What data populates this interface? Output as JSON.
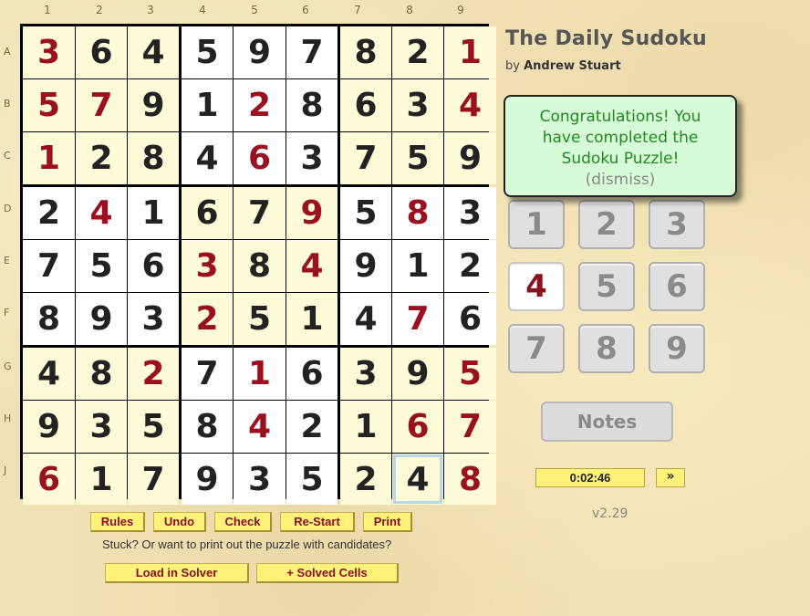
{
  "column_numbers": [
    "1",
    "2",
    "3",
    "4",
    "5",
    "6",
    "7",
    "8",
    "9"
  ],
  "row_letters": [
    "A",
    "B",
    "C",
    "D",
    "E",
    "F",
    "G",
    "H",
    "J"
  ],
  "grid": [
    [
      "3",
      "6",
      "4",
      "5",
      "9",
      "7",
      "8",
      "2",
      "1"
    ],
    [
      "5",
      "7",
      "9",
      "1",
      "2",
      "8",
      "6",
      "3",
      "4"
    ],
    [
      "1",
      "2",
      "8",
      "4",
      "6",
      "3",
      "7",
      "5",
      "9"
    ],
    [
      "2",
      "4",
      "1",
      "6",
      "7",
      "9",
      "5",
      "8",
      "3"
    ],
    [
      "7",
      "5",
      "6",
      "3",
      "8",
      "4",
      "9",
      "1",
      "2"
    ],
    [
      "8",
      "9",
      "3",
      "2",
      "5",
      "1",
      "4",
      "7",
      "6"
    ],
    [
      "4",
      "8",
      "2",
      "7",
      "1",
      "6",
      "3",
      "9",
      "5"
    ],
    [
      "9",
      "3",
      "5",
      "8",
      "4",
      "2",
      "1",
      "6",
      "7"
    ],
    [
      "6",
      "1",
      "7",
      "9",
      "3",
      "5",
      "2",
      "4",
      "8"
    ]
  ],
  "given_cells": [
    [
      0,
      0
    ],
    [
      0,
      8
    ],
    [
      1,
      0
    ],
    [
      1,
      1
    ],
    [
      1,
      4
    ],
    [
      1,
      8
    ],
    [
      2,
      0
    ],
    [
      2,
      4
    ],
    [
      3,
      1
    ],
    [
      3,
      5
    ],
    [
      3,
      7
    ],
    [
      4,
      3
    ],
    [
      4,
      5
    ],
    [
      5,
      3
    ],
    [
      5,
      7
    ],
    [
      6,
      2
    ],
    [
      6,
      4
    ],
    [
      6,
      8
    ],
    [
      7,
      4
    ],
    [
      7,
      7
    ],
    [
      7,
      8
    ],
    [
      8,
      0
    ],
    [
      8,
      8
    ]
  ],
  "selected_cell": [
    8,
    7
  ],
  "title": "The Daily Sudoku",
  "byline_prefix": "by",
  "byline_author": "Andrew Stuart",
  "popup": {
    "message": "Congratulations! You have completed the Sudoku Puzzle!",
    "dismiss": "(dismiss)"
  },
  "numpad": [
    "1",
    "2",
    "3",
    "4",
    "5",
    "6",
    "7",
    "8",
    "9"
  ],
  "numpad_active": "4",
  "notes_label": "Notes",
  "timer": "0:02:46",
  "timer_next": "»",
  "version": "v2.29",
  "buttons": {
    "rules": "Rules",
    "undo": "Undo",
    "check": "Check",
    "restart": "Re-Start",
    "print": "Print"
  },
  "stuck_text": "Stuck? Or want to print out the puzzle with candidates?",
  "solver_buttons": {
    "load": "Load in Solver",
    "solved": "+ Solved Cells"
  },
  "colors": {
    "given_digit": "#9a1020",
    "entered_digit": "#222222",
    "tint_box": "#fdfbd8",
    "popup_bg": "#d8fbd8",
    "popup_text": "#1f8a1f",
    "button_bg": "#fff27a"
  }
}
